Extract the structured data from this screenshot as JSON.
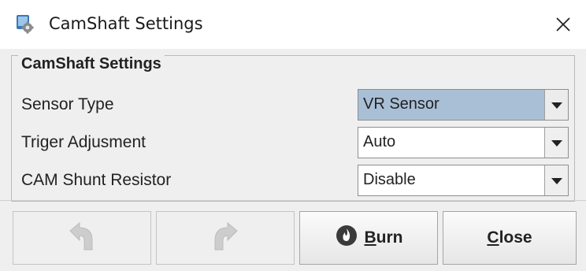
{
  "window": {
    "title": "CamShaft Settings",
    "icons": {
      "app": "gear-app-icon",
      "close": "close-icon"
    }
  },
  "group": {
    "title": "CamShaft Settings",
    "rows": [
      {
        "label": "Sensor Type",
        "value": "VR Sensor",
        "selected": true
      },
      {
        "label": "Triger Adjusment",
        "value": "Auto",
        "selected": false
      },
      {
        "label": "CAM Shunt Resistor",
        "value": "Disable",
        "selected": false
      }
    ]
  },
  "buttons": {
    "undo": {
      "icon": "undo-icon",
      "enabled": false
    },
    "redo": {
      "icon": "redo-icon",
      "enabled": false
    },
    "burn": {
      "mnemonic": "B",
      "rest": "urn",
      "icon": "burn-flame-icon"
    },
    "close": {
      "mnemonic": "C",
      "rest": "lose"
    }
  },
  "colors": {
    "selected_combo": "#a9bfd6",
    "burn_icon": "#3a3a3a"
  }
}
